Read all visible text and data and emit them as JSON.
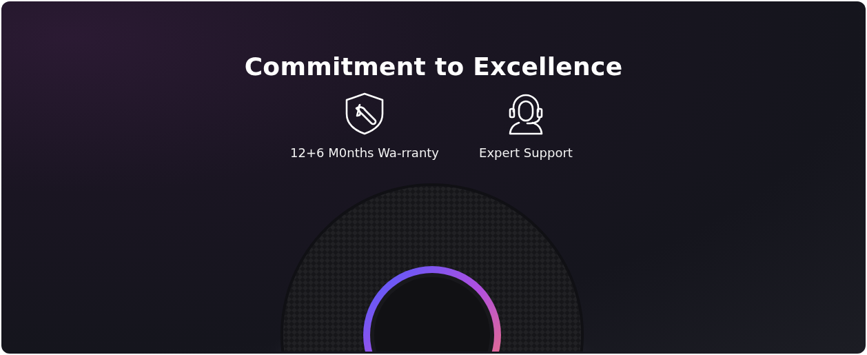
{
  "title": "Commitment to Excellence",
  "features": [
    {
      "kind": "warranty",
      "label": "12+6 M0nths Wa-rranty"
    },
    {
      "kind": "support",
      "label": "Expert Support"
    }
  ]
}
